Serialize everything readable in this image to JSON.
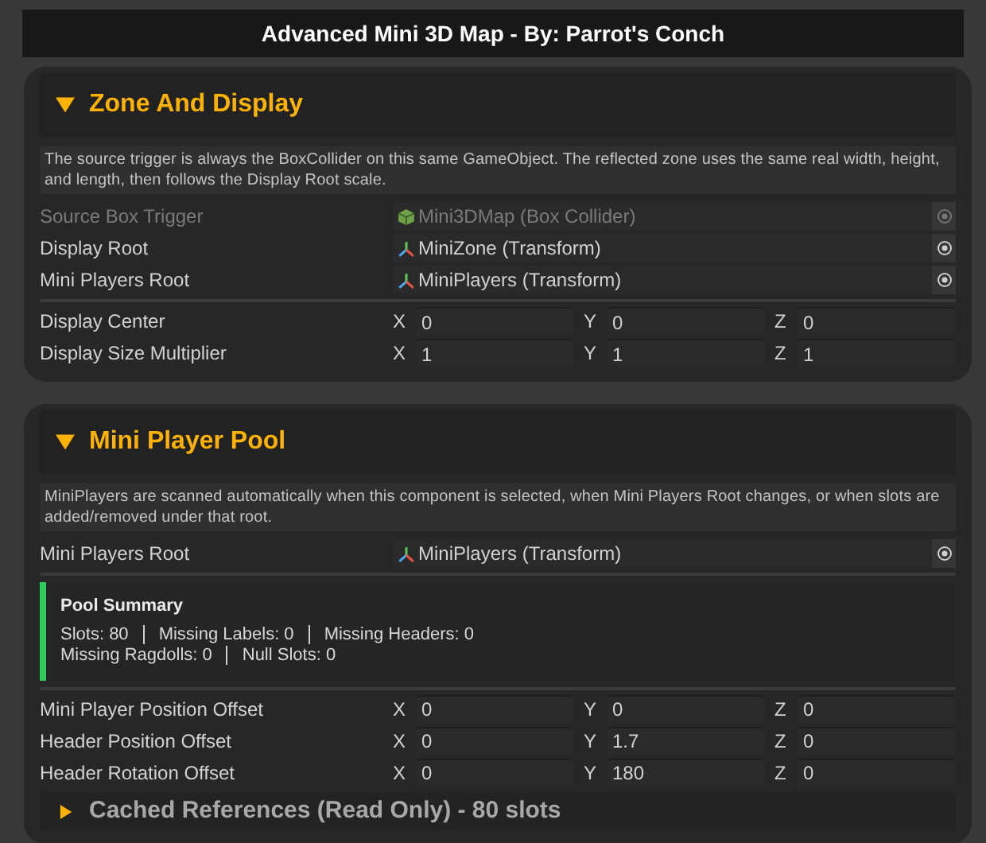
{
  "title": "Advanced Mini 3D Map - By: Parrot's Conch",
  "sections": [
    {
      "title": "Zone And Display",
      "expanded": true,
      "items": [
        {
          "kind": "help",
          "text": "The source trigger is always the BoxCollider on this same GameObject. The reflected zone uses the same real width, height, and length, then follows the Display Root scale."
        },
        {
          "kind": "collider",
          "label": "Source Box Trigger",
          "value": "Mini3DMap (Box Collider)",
          "disabled": true
        },
        {
          "kind": "transform",
          "label": "Display Root",
          "value": "MiniZone (Transform)",
          "disabled": false
        },
        {
          "kind": "transform",
          "label": "Mini Players Root",
          "value": "MiniPlayers (Transform)",
          "disabled": false
        },
        {
          "kind": "separator"
        },
        {
          "kind": "vector",
          "label": "Display Center",
          "axes": [
            {
              "axis": "X",
              "value": "0"
            },
            {
              "axis": "Y",
              "value": "0"
            },
            {
              "axis": "Z",
              "value": "0"
            }
          ]
        },
        {
          "kind": "vector",
          "label": "Display Size Multiplier",
          "axes": [
            {
              "axis": "X",
              "value": "1"
            },
            {
              "axis": "Y",
              "value": "1"
            },
            {
              "axis": "Z",
              "value": "1"
            }
          ]
        }
      ]
    },
    {
      "title": "Mini Player Pool",
      "expanded": true,
      "items": [
        {
          "kind": "help",
          "text": "MiniPlayers are scanned automatically when this component is selected, when Mini Players Root changes, or when slots are added/removed under that root."
        },
        {
          "kind": "transform",
          "label": "Mini Players Root",
          "value": "MiniPlayers (Transform)",
          "disabled": false
        },
        {
          "kind": "separator"
        },
        {
          "kind": "summary",
          "title": "Pool Summary",
          "color": "#2ecc5a",
          "lines": [
            [
              "Slots: 80",
              "Missing Labels: 0",
              "Missing Headers: 0"
            ],
            [
              "Missing Ragdolls: 0",
              "Null Slots: 0"
            ]
          ]
        },
        {
          "kind": "separator"
        },
        {
          "kind": "vector",
          "label": "Mini Player Position Offset",
          "axes": [
            {
              "axis": "X",
              "value": "0"
            },
            {
              "axis": "Y",
              "value": "0"
            },
            {
              "axis": "Z",
              "value": "0"
            }
          ]
        },
        {
          "kind": "vector",
          "label": "Header Position Offset",
          "axes": [
            {
              "axis": "X",
              "value": "0"
            },
            {
              "axis": "Y",
              "value": "1.7"
            },
            {
              "axis": "Z",
              "value": "0"
            }
          ]
        },
        {
          "kind": "vector",
          "label": "Header Rotation Offset",
          "axes": [
            {
              "axis": "X",
              "value": "0"
            },
            {
              "axis": "Y",
              "value": "180"
            },
            {
              "axis": "Z",
              "value": "0"
            }
          ]
        },
        {
          "kind": "foldout",
          "label": "Cached References (Read Only) - 80 slots",
          "expanded": false
        }
      ]
    }
  ]
}
